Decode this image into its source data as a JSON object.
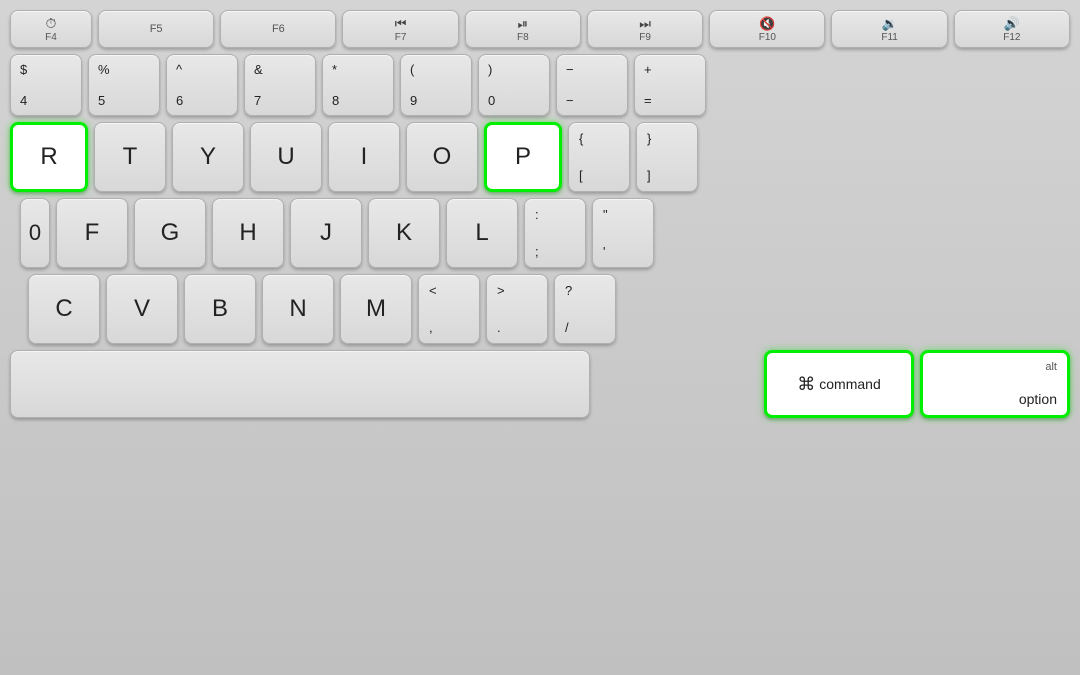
{
  "keyboard": {
    "background_color": "#c8c8c8",
    "highlight_color": "#00ee00",
    "rows": {
      "fn_row": {
        "keys": [
          {
            "id": "f4",
            "label": "F4",
            "icon": "⏱",
            "sub": "F4"
          },
          {
            "id": "f5",
            "label": "F5"
          },
          {
            "id": "f6",
            "label": "F6"
          },
          {
            "id": "f7",
            "label": "◀◀",
            "sub": "F7"
          },
          {
            "id": "f8",
            "label": "▶⏸",
            "sub": "F8"
          },
          {
            "id": "f9",
            "label": "▶▶",
            "sub": "F9"
          },
          {
            "id": "f10",
            "label": "🔇",
            "sub": "F10"
          },
          {
            "id": "f11",
            "label": "🔉",
            "sub": "F11"
          },
          {
            "id": "f12",
            "label": "🔊",
            "sub": "F12"
          }
        ]
      },
      "num_row": {
        "keys": [
          {
            "id": "4",
            "top": "$",
            "bot": "4"
          },
          {
            "id": "5",
            "top": "%",
            "bot": "5"
          },
          {
            "id": "6",
            "top": "^",
            "bot": "6"
          },
          {
            "id": "7",
            "top": "&",
            "bot": "7"
          },
          {
            "id": "8",
            "top": "*",
            "bot": "8"
          },
          {
            "id": "9",
            "top": "(",
            "bot": "9"
          },
          {
            "id": "0",
            "top": ")",
            "bot": "0"
          },
          {
            "id": "minus",
            "top": "−",
            "bot": "−"
          },
          {
            "id": "equal",
            "top": "+",
            "bot": "="
          }
        ]
      },
      "qwerty_row": {
        "keys": [
          "R",
          "T",
          "Y",
          "U",
          "I",
          "O",
          "P"
        ],
        "bracket_keys": [
          {
            "top": "{",
            "bot": "["
          },
          {
            "top": "}",
            "bot": "]"
          }
        ],
        "highlighted": [
          "R",
          "P"
        ]
      },
      "asdf_row": {
        "keys": [
          "F",
          "G",
          "H",
          "J",
          "K",
          "L"
        ],
        "special_keys": [
          {
            "top": ":",
            "bot": ";"
          },
          {
            "top": "\"",
            "bot": "'"
          }
        ]
      },
      "zxcv_row": {
        "keys": [
          "C",
          "V",
          "B",
          "N",
          "M"
        ],
        "special_keys": [
          {
            "top": "<",
            "bot": ","
          },
          {
            "top": ">",
            "bot": "."
          },
          {
            "top": "?",
            "bot": "/"
          }
        ]
      },
      "bottom_row": {
        "command_label": "command",
        "command_symbol": "⌘",
        "option_label": "option",
        "option_alt": "alt"
      }
    }
  }
}
